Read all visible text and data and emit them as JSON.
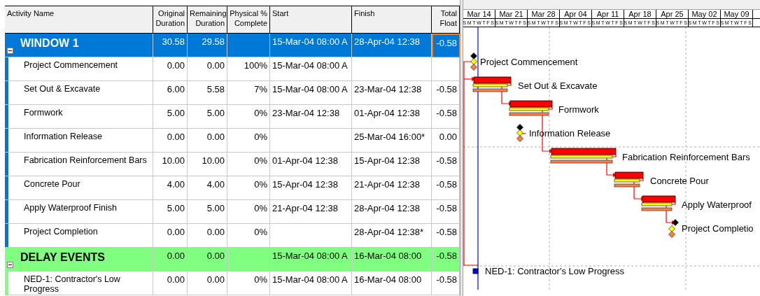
{
  "columns": [
    {
      "label": "Activity Name",
      "kind": "text"
    },
    {
      "label": "Original Duration",
      "kind": "number"
    },
    {
      "label": "Remaining Duration",
      "kind": "number"
    },
    {
      "label": "Physical % Complete",
      "kind": "number"
    },
    {
      "label": "Start",
      "kind": "text"
    },
    {
      "label": "Finish",
      "kind": "text"
    },
    {
      "label": "Total Float",
      "kind": "number"
    }
  ],
  "groups": [
    {
      "name": "WINDOW 1",
      "color": "#0078d7",
      "expanded": true,
      "cells": [
        "30.58",
        "29.58",
        "",
        "15-Mar-04 08:00 A",
        "28-Apr-04 12:38",
        "-0.58"
      ],
      "float_focused": true,
      "activities": [
        {
          "name": "Project Commencement",
          "cells": [
            "0.00",
            "0.00",
            "100%",
            "15-Mar-04 08:00 A",
            "",
            ""
          ]
        },
        {
          "name": "Set Out & Excavate",
          "cells": [
            "6.00",
            "5.58",
            "7%",
            "15-Mar-04 08:00 A",
            "23-Mar-04 12:38",
            "-0.58"
          ]
        },
        {
          "name": "Formwork",
          "cells": [
            "5.00",
            "5.00",
            "0%",
            "23-Mar-04 12:38",
            "01-Apr-04 12:38",
            "-0.58"
          ]
        },
        {
          "name": "Information Release",
          "cells": [
            "0.00",
            "0.00",
            "0%",
            "",
            "25-Mar-04 16:00*",
            "0.00"
          ]
        },
        {
          "name": "Fabrication Reinforcement Bars",
          "cells": [
            "10.00",
            "10.00",
            "0%",
            "01-Apr-04 12:38",
            "15-Apr-04 12:38",
            "-0.58"
          ]
        },
        {
          "name": "Concrete Pour",
          "cells": [
            "4.00",
            "4.00",
            "0%",
            "15-Apr-04 12:38",
            "21-Apr-04 12:38",
            "-0.58"
          ]
        },
        {
          "name": "Apply Waterproof Finish",
          "cells": [
            "5.00",
            "5.00",
            "0%",
            "21-Apr-04 12:38",
            "28-Apr-04 12:38",
            "-0.58"
          ]
        },
        {
          "name": "Project Completion",
          "cells": [
            "0.00",
            "0.00",
            "0%",
            "",
            "28-Apr-04 12:38*",
            "-0.58"
          ]
        }
      ]
    },
    {
      "name": "DELAY EVENTS",
      "color": "#80ff80",
      "expanded": true,
      "cells": [
        "0.00",
        "0.00",
        "",
        "15-Mar-04 08:00 A",
        "16-Mar-04 08:00",
        "-0.58"
      ],
      "float_focused": false,
      "activities": [
        {
          "name": "NED-1: Contractor's Low Progress",
          "cells": [
            "0.00",
            "0.00",
            "0%",
            "15-Mar-04 08:00 A",
            "16-Mar-04 08:00",
            "-0.58"
          ]
        }
      ]
    }
  ],
  "gantt": {
    "weeks": [
      {
        "label": "Mar 14",
        "days": "SMTWTFS"
      },
      {
        "label": "Mar 21",
        "days": "SMTWTFS"
      },
      {
        "label": "Mar 28",
        "days": "SMTWTFS"
      },
      {
        "label": "Apr 04",
        "days": "SMTWTFS"
      },
      {
        "label": "Apr 11",
        "days": "SMTWTFS"
      },
      {
        "label": "Apr 18",
        "days": "SMTWTFS"
      },
      {
        "label": "Apr 25",
        "days": "SMTWTFS"
      },
      {
        "label": "May 02",
        "days": "SMTWTFS"
      },
      {
        "label": "May 09",
        "days": "SMTWTFS"
      }
    ],
    "items": [
      {
        "kind": "milestone",
        "label": "Project Commencement"
      },
      {
        "kind": "task",
        "label": "Set Out & Excavate"
      },
      {
        "kind": "task",
        "label": "Formwork"
      },
      {
        "kind": "milestone",
        "label": "Information Release"
      },
      {
        "kind": "task",
        "label": "Fabrication Reinforcement Bars"
      },
      {
        "kind": "task",
        "label": "Concrete Pour"
      },
      {
        "kind": "task",
        "label": "Apply Waterproof"
      },
      {
        "kind": "finish_milestone",
        "label": "Project Completio"
      },
      {
        "kind": "delay",
        "label": "NED-1: Contractor's Low Progress"
      }
    ]
  }
}
